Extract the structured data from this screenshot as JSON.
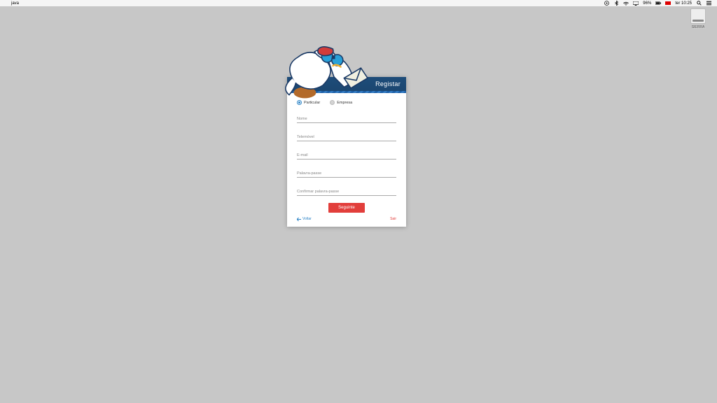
{
  "menubar": {
    "app": "java",
    "battery": "96%",
    "day_time": "ter 10:25"
  },
  "desktop": {
    "drive_label": "SIERRA"
  },
  "modal": {
    "title": "Registar",
    "account_type": {
      "particular": "Particular",
      "empresa": "Empresa",
      "selected": "particular"
    },
    "fields": {
      "name_ph": "Nome",
      "phone_ph": "Telemóvel",
      "email_ph": "E-mail",
      "password_ph": "Palavra-passe",
      "confirm_ph": "Confirmar palavra-passe"
    },
    "buttons": {
      "next": "Seguinte",
      "back": "Voltar",
      "exit": "Sair"
    }
  }
}
